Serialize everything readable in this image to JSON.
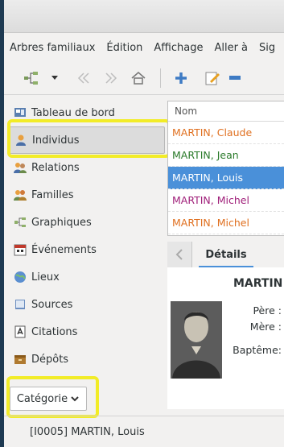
{
  "menu": [
    "Arbres familiaux",
    "Édition",
    "Affichage",
    "Aller à",
    "Sig"
  ],
  "sidebar": {
    "items": [
      {
        "label": "Tableau de bord",
        "icon": "dashboard-icon"
      },
      {
        "label": "Individus",
        "icon": "person-icon"
      },
      {
        "label": "Relations",
        "icon": "relations-icon"
      },
      {
        "label": "Familles",
        "icon": "families-icon"
      },
      {
        "label": "Graphiques",
        "icon": "charts-icon"
      },
      {
        "label": "Événements",
        "icon": "calendar-icon"
      },
      {
        "label": "Lieux",
        "icon": "globe-icon"
      },
      {
        "label": "Sources",
        "icon": "book-icon"
      },
      {
        "label": "Citations",
        "icon": "citation-icon"
      },
      {
        "label": "Dépôts",
        "icon": "repository-icon"
      }
    ],
    "category_label": "Catégorie"
  },
  "list": {
    "header": "Nom",
    "rows": [
      {
        "name": "MARTIN, Claude",
        "color": "#e07020"
      },
      {
        "name": "MARTIN, Jean",
        "color": "#2a7a2a"
      },
      {
        "name": "MARTIN, Louis",
        "color": "#ffffff"
      },
      {
        "name": "MARTIN, Michel",
        "color": "#a0207a"
      },
      {
        "name": "MARTIN, Michel",
        "color": "#e07020"
      }
    ]
  },
  "tabs": {
    "details_label": "Détails"
  },
  "detail": {
    "name": "MARTIN",
    "father_label": "Père :",
    "mother_label": "Mère :",
    "baptism_label": "Baptême:"
  },
  "status": {
    "text": "[I0005] MARTIN, Louis"
  },
  "colors": {
    "accent": "#4a90d9",
    "highlight": "#f2ec27"
  }
}
